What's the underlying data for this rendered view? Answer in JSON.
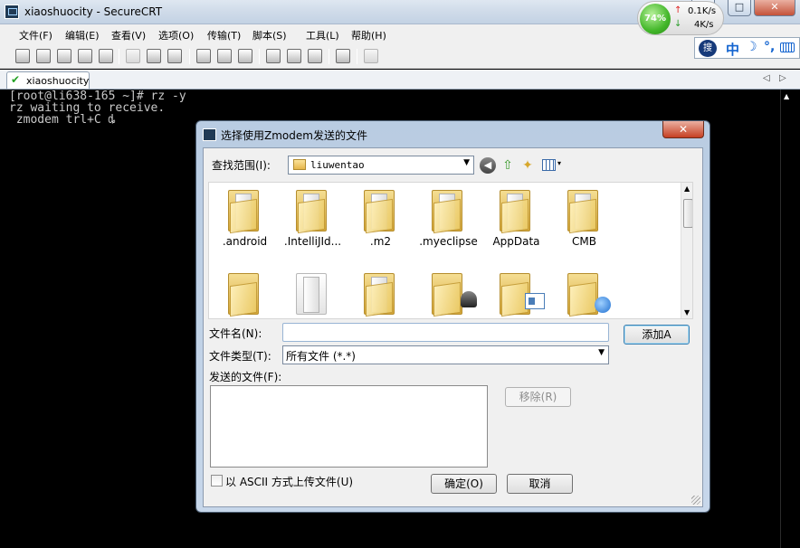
{
  "window": {
    "title": "xiaoshuocity - SecureCRT",
    "min_label": "—",
    "max_label": "□",
    "close_label": "✕"
  },
  "net_monitor": {
    "percent": "74%",
    "up_arrow": "↑",
    "down_arrow": "↓",
    "upload": "0.1K/s",
    "download": "4K/s"
  },
  "ime": {
    "logo": "搜",
    "mode": "中",
    "moon": "☽",
    "punct": "°,"
  },
  "menu": {
    "items": [
      {
        "label": "文件(F)"
      },
      {
        "label": "编辑(E)"
      },
      {
        "label": "查看(V)"
      },
      {
        "label": "选项(O)"
      },
      {
        "label": "传输(T)"
      },
      {
        "label": "脚本(S)"
      },
      {
        "label": "工具(L)"
      },
      {
        "label": "帮助(H)"
      }
    ]
  },
  "toolbar": {
    "icons": [
      "connect-icon",
      "quick-connect-icon",
      "connect-tab-icon",
      "reconnect-icon",
      "disconnect-icon",
      "copy-icon",
      "paste-icon",
      "find-icon",
      "print-setup-icon",
      "print-selection-icon",
      "print-icon",
      "session-options-icon",
      "global-options-icon",
      "keymap-icon",
      "help-icon",
      "sftp-icon"
    ]
  },
  "tabs": {
    "session": "xiaoshuocity",
    "check": "✔",
    "scroll_left": "◁",
    "scroll_right": "▷"
  },
  "terminal": {
    "lines": [
      "[root@li638-165 ~]# rz -y",
      "rz waiting to receive.",
      " zmodem trl+C ȡ"
    ],
    "scroll_up": "▲"
  },
  "dialog": {
    "title": "选择使用Zmodem发送的文件",
    "close_label": "✕",
    "look_in_label": "查找范围(I):",
    "look_in_value": "liuwentao",
    "combo_arrow": "▼",
    "nav": {
      "back": "◀",
      "up": "⇧",
      "new_folder": "✦",
      "view_drop": "▾"
    },
    "files": [
      {
        "name": ".android",
        "badge": ""
      },
      {
        "name": ".IntelliJId...",
        "badge": ""
      },
      {
        "name": ".m2",
        "badge": ""
      },
      {
        "name": ".myeclipse",
        "badge": ""
      },
      {
        "name": "AppData",
        "badge": ""
      },
      {
        "name": "CMB",
        "badge": ""
      },
      {
        "name": "",
        "badge": ""
      },
      {
        "name": "",
        "badge": "paper"
      },
      {
        "name": "",
        "badge": ""
      },
      {
        "name": "",
        "badge": "chess"
      },
      {
        "name": "",
        "badge": "card"
      },
      {
        "name": "",
        "badge": "shortcut"
      }
    ],
    "scroll_up": "▲",
    "scroll_down": "▼",
    "file_name_label": "文件名(N):",
    "file_name_value": "",
    "add_button": "添加A",
    "file_type_label": "文件类型(T):",
    "file_type_value": "所有文件 (*.*)",
    "send_list_label": "发送的文件(F):",
    "remove_button": "移除(R)",
    "ascii_label": "以 ASCII 方式上传文件(U)",
    "ascii_checked": false,
    "ok_button": "确定(O)",
    "cancel_button": "取消"
  }
}
